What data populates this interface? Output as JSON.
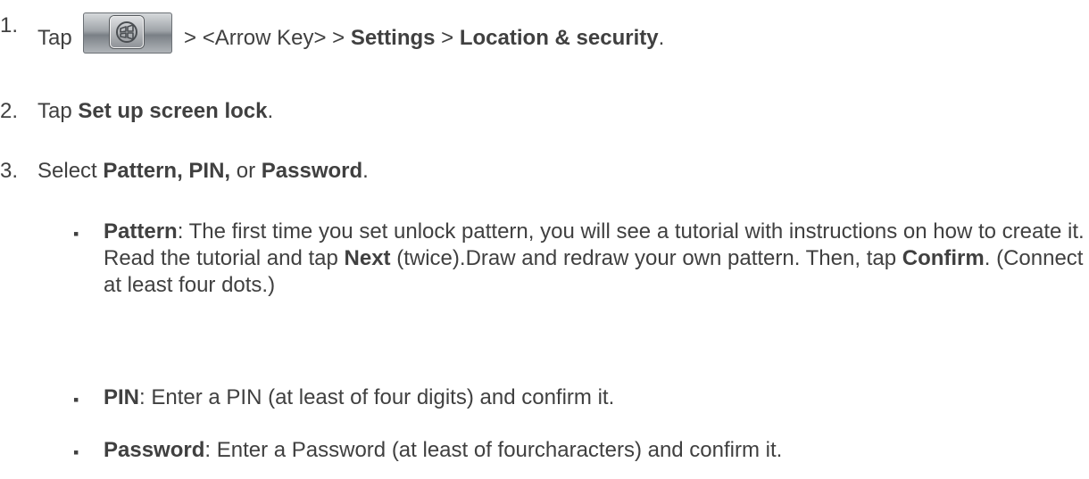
{
  "steps": [
    {
      "num": "1.",
      "prefix": "Tap",
      "icon": "home-key-icon",
      "middle": "> <Arrow Key> >",
      "settings": "Settings",
      "sep": ">",
      "location": "Location & security",
      "end": "."
    },
    {
      "num": "2.",
      "prefix": "Tap",
      "bold": "Set up screen lock",
      "end": "."
    },
    {
      "num": "3.",
      "prefix": "Select",
      "bold1": "Pattern, PIN,",
      "mid": "or",
      "bold2": "Password",
      "end": "."
    }
  ],
  "bullets": [
    {
      "marker": "▪",
      "title": "Pattern",
      "text1": ": The first time you set unlock pattern, you will see a tutorial with instructions on how to create it. Read the tutorial and tap",
      "next": "Next",
      "text2": "(twice).Draw and redraw your own pattern. Then, tap",
      "confirm": "Confirm",
      "text3": ". (Connect at least four dots.)"
    },
    {
      "marker": "▪",
      "title": "PIN",
      "text": ": Enter a PIN (at least of four digits) and confirm it."
    },
    {
      "marker": "▪",
      "title": "Password",
      "text": ": Enter a Password (at least of fourcharacters) and confirm it."
    }
  ]
}
